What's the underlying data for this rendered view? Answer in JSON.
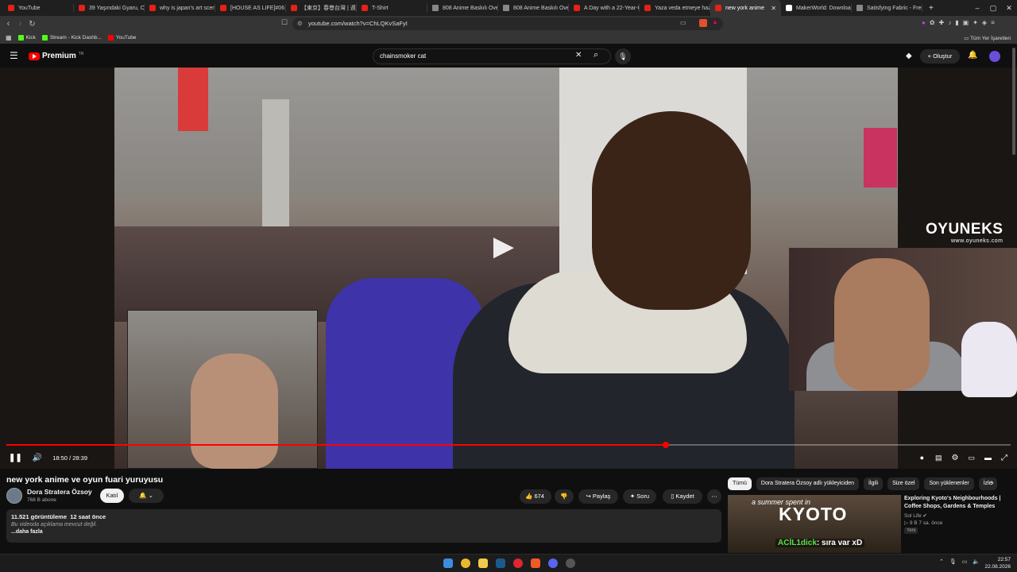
{
  "browser": {
    "tabs": [
      {
        "label": "YouTube",
        "icon": "youtube-icon"
      },
      {
        "label": "39 Yaşındaki Gyaru, Osa",
        "icon": "youtube-icon"
      },
      {
        "label": "why is japan's art scene",
        "icon": "youtube-icon"
      },
      {
        "label": "[HOUSE AS LIFE]#06 三",
        "icon": "youtube-icon"
      },
      {
        "label": "【東京】春巻台灣 | 週刊",
        "icon": "youtube-icon"
      },
      {
        "label": "T-Shirt",
        "icon": "youtube-icon"
      },
      {
        "label": "808 Anime Baskılı Overs",
        "icon": "generic-icon"
      },
      {
        "label": "808 Anime Baskılı Overs",
        "icon": "generic-icon"
      },
      {
        "label": "A Day with a 22-Year-O",
        "icon": "youtube-icon"
      },
      {
        "label": "Yaza veda etmeye hazır",
        "icon": "youtube-icon"
      },
      {
        "label": "new york anime",
        "icon": "youtube-icon",
        "active": true
      },
      {
        "label": "MakerWorld: Download",
        "icon": "makerworld-icon"
      },
      {
        "label": "Satisfying Fabric - Free 3",
        "icon": "generic-icon"
      }
    ],
    "new_tab": "+",
    "url": "youtube.com/watch?v=ChLQKvSaFyI",
    "bookmarks": [
      {
        "label": "Kick",
        "color": "#53fc18"
      },
      {
        "label": "Stream - Kick Dashb...",
        "color": "#53fc18"
      },
      {
        "label": "YouTube",
        "color": "#ff0000"
      }
    ],
    "all_bookmarks": "Tüm Yer İşaretleri"
  },
  "youtube": {
    "logo_text": "Premium",
    "logo_sup": "TR",
    "search_value": "chainsmoker cat",
    "create_label": "Oluştur"
  },
  "video": {
    "overlay_logo": "OYUNEKS",
    "overlay_url": "www.oyuneks.com",
    "time": "18:50 / 28:39",
    "progress": 0.657
  },
  "meta": {
    "title": "new york anime ve oyun fuari yuruyusu",
    "channel": "Dora Stratera Özsoy",
    "subscribers": "768 B abone",
    "join_label": "Katıl",
    "likes": "674",
    "share_label": "Paylaş",
    "ask_label": "Soru",
    "save_label": "Kaydet",
    "views_line": "11.521 görüntüleme  12 saat önce",
    "desc_line": "Bu videoda açıklama mevcut değil.",
    "more_label": "...daha fazla"
  },
  "sidebar": {
    "chips": [
      "Tümü",
      "Dora Stratera Özsoy adlı yükleyiciden",
      "İlgili",
      "Size özel",
      "Son yüklenenler",
      "İzle"
    ],
    "rec": {
      "thumb_line1": "a summer spent in",
      "thumb_line2": "KYOTO",
      "thumb_chat_user": "ACİL1dick",
      "thumb_chat_msg": ": sıra var xD",
      "title": "Exploring Kyoto's Neighbourhoods | Coffee Shops, Gardens & Temples",
      "channel": "Sol Life",
      "stats": "9 B  7 sa. önce",
      "badge": "Yeni"
    }
  },
  "taskbar": {
    "time": "22:57",
    "date": "22.08.2026"
  }
}
